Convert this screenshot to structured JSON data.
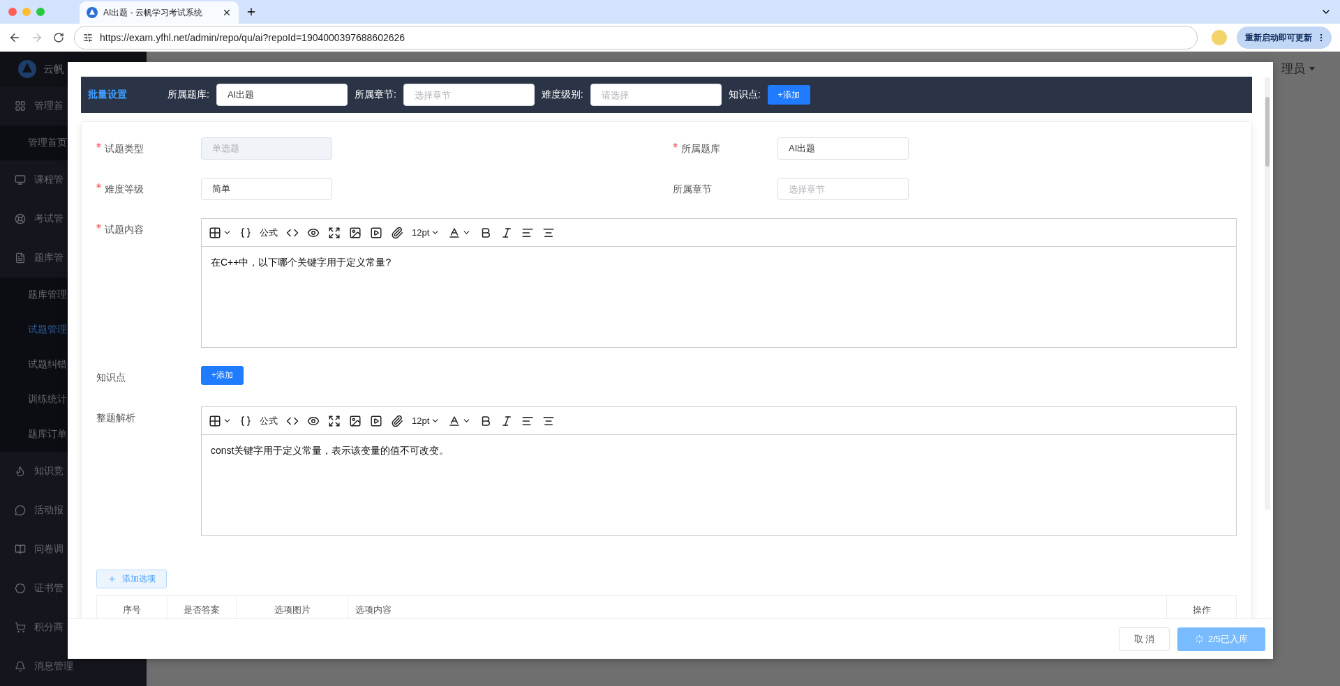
{
  "browser": {
    "tab": {
      "title": "AI出题 - 云帆学习考试系统",
      "selected": true
    },
    "url": "https://exam.yfhl.net/admin/repo/qu/ai?repoId=1904000397688602626",
    "forward_disabled": true,
    "update_button": "重新启动即可更新"
  },
  "app_header": {
    "user": "理员"
  },
  "sidebar": {
    "logo_text": "云帆",
    "items": [
      {
        "kind": "grid",
        "label": "管理首",
        "children": [
          {
            "label": "管理首页",
            "selected": false
          }
        ]
      },
      {
        "kind": "monitor",
        "label": "课程管"
      },
      {
        "kind": "target",
        "label": "考试管"
      },
      {
        "kind": "doc",
        "label": "题库管",
        "children": [
          {
            "label": "题库管理",
            "selected": false
          },
          {
            "label": "试题管理",
            "selected": true
          },
          {
            "label": "试题纠错",
            "selected": false
          },
          {
            "label": "训练统计",
            "selected": false
          },
          {
            "label": "题库订单",
            "selected": false
          }
        ]
      },
      {
        "kind": "fire",
        "label": "知识竞"
      },
      {
        "kind": "chat",
        "label": "活动报"
      },
      {
        "kind": "book",
        "label": "问卷调"
      },
      {
        "kind": "seal",
        "label": "证书管"
      },
      {
        "kind": "cart",
        "label": "积分商"
      },
      {
        "kind": "bell",
        "label": "消息管理"
      }
    ]
  },
  "batch_bar": {
    "title": "批量设置",
    "fields": [
      {
        "label": "所属题库:",
        "value": "AI出题"
      },
      {
        "label": "所属章节:",
        "placeholder": "选择章节"
      },
      {
        "label": "难度级别:",
        "placeholder": "请选择"
      }
    ],
    "knowledge": {
      "label": "知识点:",
      "button": "+添加"
    }
  },
  "form": {
    "fields": [
      {
        "label": "试题类型",
        "required": true,
        "value": "单选题",
        "disabled": true
      },
      {
        "label": "所属题库",
        "required": true,
        "value": "AI出题",
        "disabled": false
      },
      {
        "label": "难度等级",
        "required": true,
        "value": "简单",
        "disabled": false
      },
      {
        "label": "所属章节",
        "required": false,
        "placeholder": "选择章节",
        "disabled": false
      }
    ],
    "content_editor": {
      "label": "试题内容",
      "required": true,
      "formula": "公式",
      "font_size": "12pt",
      "content": "在C++中，以下哪个关键字用于定义常量?"
    },
    "knowledge": {
      "label": "知识点",
      "button": "+添加"
    },
    "analysis_editor": {
      "label": "整题解析",
      "required": false,
      "formula": "公式",
      "font_size": "12pt",
      "content": "const关键字用于定义常量，表示该变量的值不可改变。"
    },
    "add_option_button": "添加选项",
    "options_table": {
      "columns": [
        "序号",
        "是否答案",
        "选项图片",
        "选项内容",
        "操作"
      ]
    }
  },
  "footer": {
    "cancel": "取 消",
    "submit": {
      "label": "2/5已入库",
      "loading": true
    }
  }
}
